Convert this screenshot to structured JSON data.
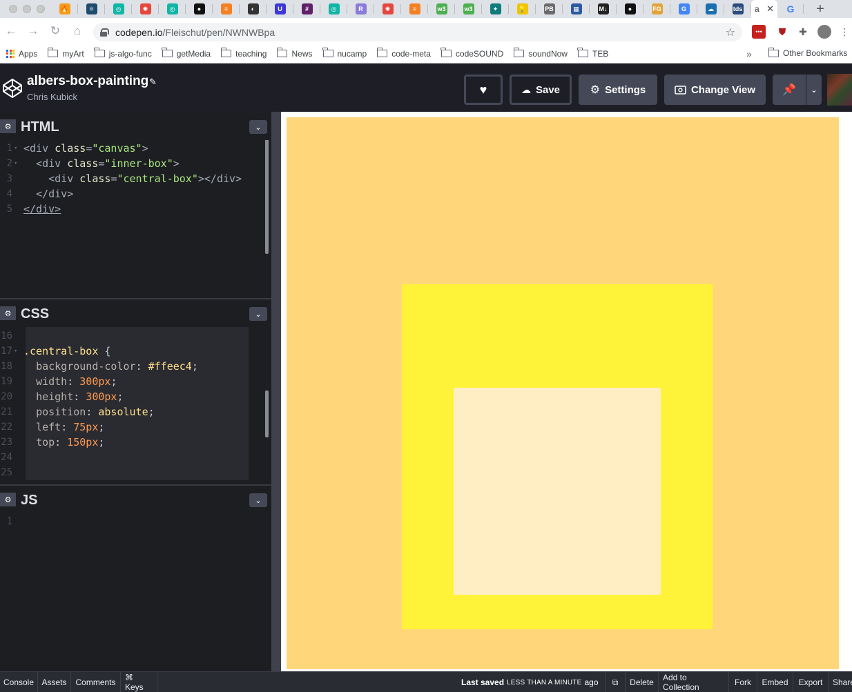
{
  "browser": {
    "active_tab_text": "a",
    "tabs": [
      {
        "icon": "flame-icon",
        "color": "#f79b1a"
      },
      {
        "icon": "react-icon",
        "color": "#1c4b6e"
      },
      {
        "icon": "codesandbox-icon",
        "color": "#11b5a5"
      },
      {
        "icon": "codepen-icon",
        "color": "#e4473d"
      },
      {
        "icon": "codesandbox-icon",
        "color": "#11b5a5"
      },
      {
        "icon": "github-icon",
        "color": "#111111"
      },
      {
        "icon": "stackoverflow-icon",
        "color": "#f48024"
      },
      {
        "icon": "globe-icon",
        "color": "#333333"
      },
      {
        "icon": "udemy-icon",
        "color": "#3b38d6"
      },
      {
        "icon": "slack-icon",
        "color": "#611f69"
      },
      {
        "icon": "codesandbox-icon",
        "color": "#11b5a5"
      },
      {
        "icon": "circle-r-icon",
        "color": "#8b7bd8"
      },
      {
        "icon": "codepen-icon",
        "color": "#e4473d"
      },
      {
        "icon": "stackoverflow-icon",
        "color": "#f48024"
      },
      {
        "icon": "w3-icon",
        "color": "#4caf50"
      },
      {
        "icon": "w3-icon",
        "color": "#4caf50"
      },
      {
        "icon": "bird-icon",
        "color": "#0f7b7b"
      },
      {
        "icon": "bulb-icon",
        "color": "#f0c400"
      },
      {
        "icon": "pb-icon",
        "color": "#6a6a6a"
      },
      {
        "icon": "grid-icon",
        "color": "#2c5aa0"
      },
      {
        "icon": "md-icon",
        "color": "#222222"
      },
      {
        "icon": "github-icon",
        "color": "#111111"
      },
      {
        "icon": "fg-icon",
        "color": "#e2a33a"
      },
      {
        "icon": "google-icon",
        "color": "#4285f4"
      },
      {
        "icon": "cloud-icon",
        "color": "#1a6fb0"
      },
      {
        "icon": "tds-icon",
        "color": "#2a4b7c"
      }
    ],
    "url_host": "codepen.io",
    "url_path": "/Fleischut/pen/NWNWBpa",
    "bookmarks": [
      "Apps",
      "myArt",
      "js-algo-func",
      "getMedia",
      "teaching",
      "News",
      "nucamp",
      "code-meta",
      "codeSOUND",
      "soundNow",
      "TEB"
    ],
    "other_bookmarks": "Other Bookmarks"
  },
  "pen": {
    "title": "albers-box-painting",
    "author": "Chris Kubick"
  },
  "header_buttons": {
    "save": "Save",
    "settings": "Settings",
    "change_view": "Change View"
  },
  "editors": {
    "html": {
      "title": "HTML",
      "lines": [
        {
          "n": "1",
          "fold": true
        },
        {
          "n": "2",
          "fold": true
        },
        {
          "n": "3",
          "fold": false
        },
        {
          "n": "4",
          "fold": false
        },
        {
          "n": "5",
          "fold": false
        }
      ]
    },
    "css": {
      "title": "CSS",
      "line_numbers": [
        "16",
        "17",
        "18",
        "19",
        "20",
        "21",
        "22",
        "23",
        "24",
        "25"
      ],
      "selector": ".central-box",
      "rules": [
        {
          "prop": "background-color",
          "value": "#ffeec4"
        },
        {
          "prop": "width",
          "value": "300px"
        },
        {
          "prop": "height",
          "value": "300px"
        },
        {
          "prop": "position",
          "value": "absolute"
        },
        {
          "prop": "left",
          "value": "75px"
        },
        {
          "prop": "top",
          "value": "150px"
        }
      ]
    },
    "js": {
      "title": "JS",
      "line_numbers": [
        "1"
      ]
    }
  },
  "preview": {
    "canvas_color": "#ffd67a",
    "inner_box_color": "#fff33a",
    "central_box_color": "#ffeec4"
  },
  "footer": {
    "left_buttons": [
      "Console",
      "Assets",
      "Comments",
      "⌘ Keys"
    ],
    "last_saved_label": "Last saved",
    "last_saved_time": "LESS THAN A MINUTE",
    "last_saved_suffix": "ago",
    "right_buttons": [
      "Delete",
      "Add to Collection",
      "Fork",
      "Embed",
      "Export",
      "Share"
    ]
  }
}
